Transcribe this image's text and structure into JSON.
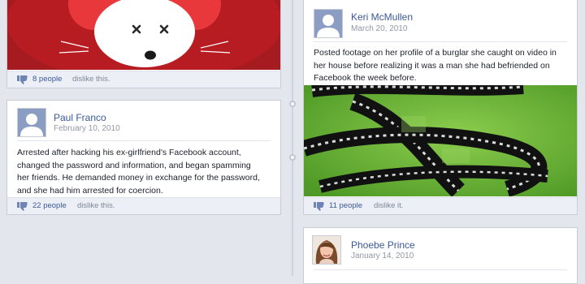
{
  "posts": [
    {
      "likes_count": "8 people",
      "likes_suffix": "dislike this.",
      "image": "cartoon-mouse-face-dead-eyes"
    },
    {
      "author": "Keri McMullen",
      "date": "March 20, 2010",
      "text_lines": [
        "Posted footage on her profile of a burglar she caught on video in",
        "her house before realizing it was a man she had befriended on",
        "Facebook the week before."
      ],
      "image": "film-reel-strip-on-green",
      "likes_count": "11 people",
      "likes_suffix": "dislike it."
    },
    {
      "author": "Paul Franco",
      "date": "February 10, 2010",
      "text_lines": [
        "Arrested after hacking his ex-girlfriend's Facebook account,",
        "changed the password and information, and began spamming",
        "her friends. He demanded money in exchange for the password,",
        "and she had him arrested for coercion."
      ],
      "likes_count": "22 people",
      "likes_suffix": "dislike this."
    },
    {
      "author": "Phoebe Prince",
      "date": "January 14, 2010"
    }
  ],
  "icons": {
    "dislike": "thumbs-down-icon",
    "avatar": "default-avatar-silhouette"
  },
  "colors": {
    "link": "#3b5998",
    "muted": "#9197a3",
    "mouse_bg": "#a51b20",
    "film_bg": "#6fb43a"
  }
}
